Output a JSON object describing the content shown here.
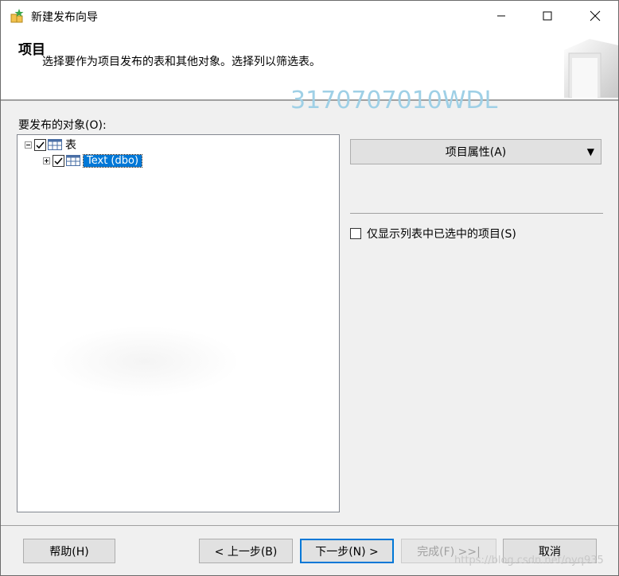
{
  "window": {
    "title": "新建发布向导"
  },
  "header": {
    "title": "项目",
    "description": "选择要作为项目发布的表和其他对象。选择列以筛选表。"
  },
  "watermark": {
    "top": "3170707010WDL",
    "bottom": "https://blog.csdn.net/oyq935"
  },
  "objects": {
    "label": "要发布的对象(O):",
    "tree": [
      {
        "label": "表",
        "checked": true,
        "expanded": true
      },
      {
        "label": "Text (dbo)",
        "checked": true,
        "expanded": false,
        "selected": true
      }
    ]
  },
  "right_panel": {
    "properties_button": "项目属性(A)",
    "show_only_checked_label": "仅显示列表中已选中的项目(S)",
    "show_only_checked": false
  },
  "footer": {
    "help": "帮助(H)",
    "back": "< 上一步(B)",
    "next": "下一步(N) >",
    "finish": "完成(F) >>|",
    "cancel": "取消"
  }
}
